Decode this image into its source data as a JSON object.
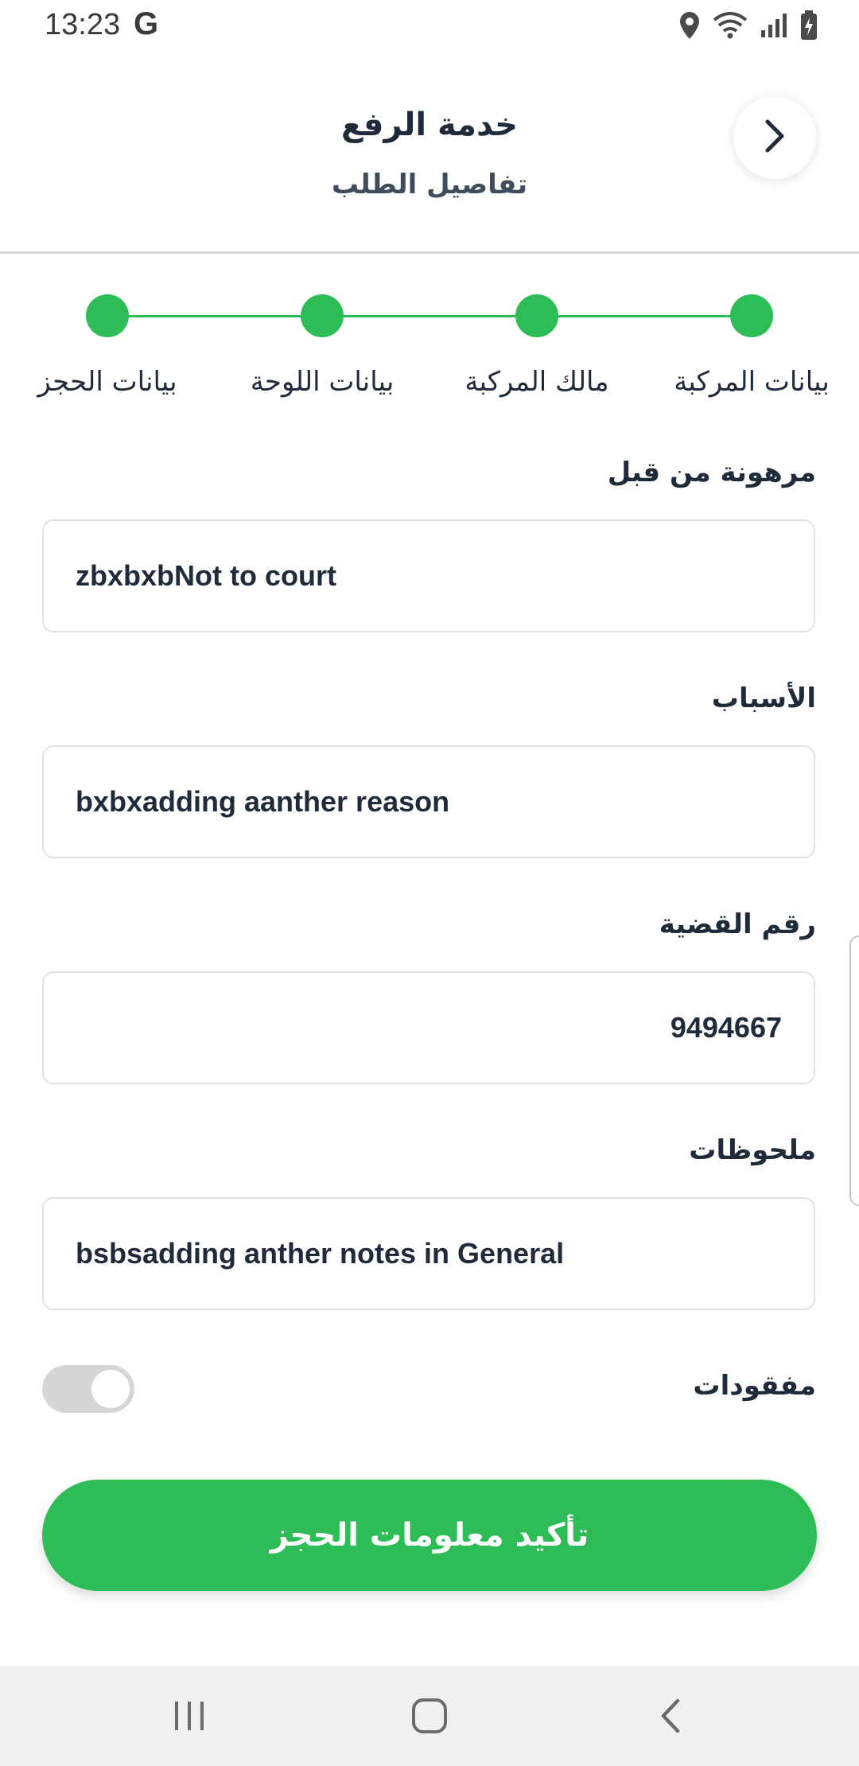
{
  "status_bar": {
    "time": "13:23",
    "google_glyph": "G",
    "icons": [
      "location-icon",
      "wifi-icon",
      "signal-icon",
      "battery-charging-icon"
    ]
  },
  "header": {
    "title": "خدمة الرفع",
    "subtitle": "تفاصيل الطلب",
    "back_icon": "chevron-right-icon"
  },
  "stepper": {
    "steps": [
      {
        "label": "بيانات المركبة",
        "completed": true
      },
      {
        "label": "مالك المركبة",
        "completed": true
      },
      {
        "label": "بيانات اللوحة",
        "completed": true
      },
      {
        "label": "بيانات الحجز",
        "completed": true
      }
    ]
  },
  "form": {
    "mortgaged": {
      "label": "مرهونة من قبل",
      "value": "zbxbxbNot to court"
    },
    "reasons": {
      "label": "الأسباب",
      "value": "bxbxadding aanther reason"
    },
    "case_number": {
      "label": "رقم القضية",
      "value": "9494667"
    },
    "notes": {
      "label": "ملحوظات",
      "value": "bsbsadding anther notes in General"
    },
    "missing": {
      "label": "مفقودات",
      "checked": false
    }
  },
  "submit": {
    "label": "تأكيد معلومات الحجز"
  },
  "nav_bar": {
    "icons": [
      "recents-icon",
      "home-icon",
      "back-icon"
    ]
  },
  "colors": {
    "accent": "#2ebc57",
    "text": "#1f2b3a",
    "border": "#e2e2e2",
    "nav_bg": "#f0f0f0"
  }
}
